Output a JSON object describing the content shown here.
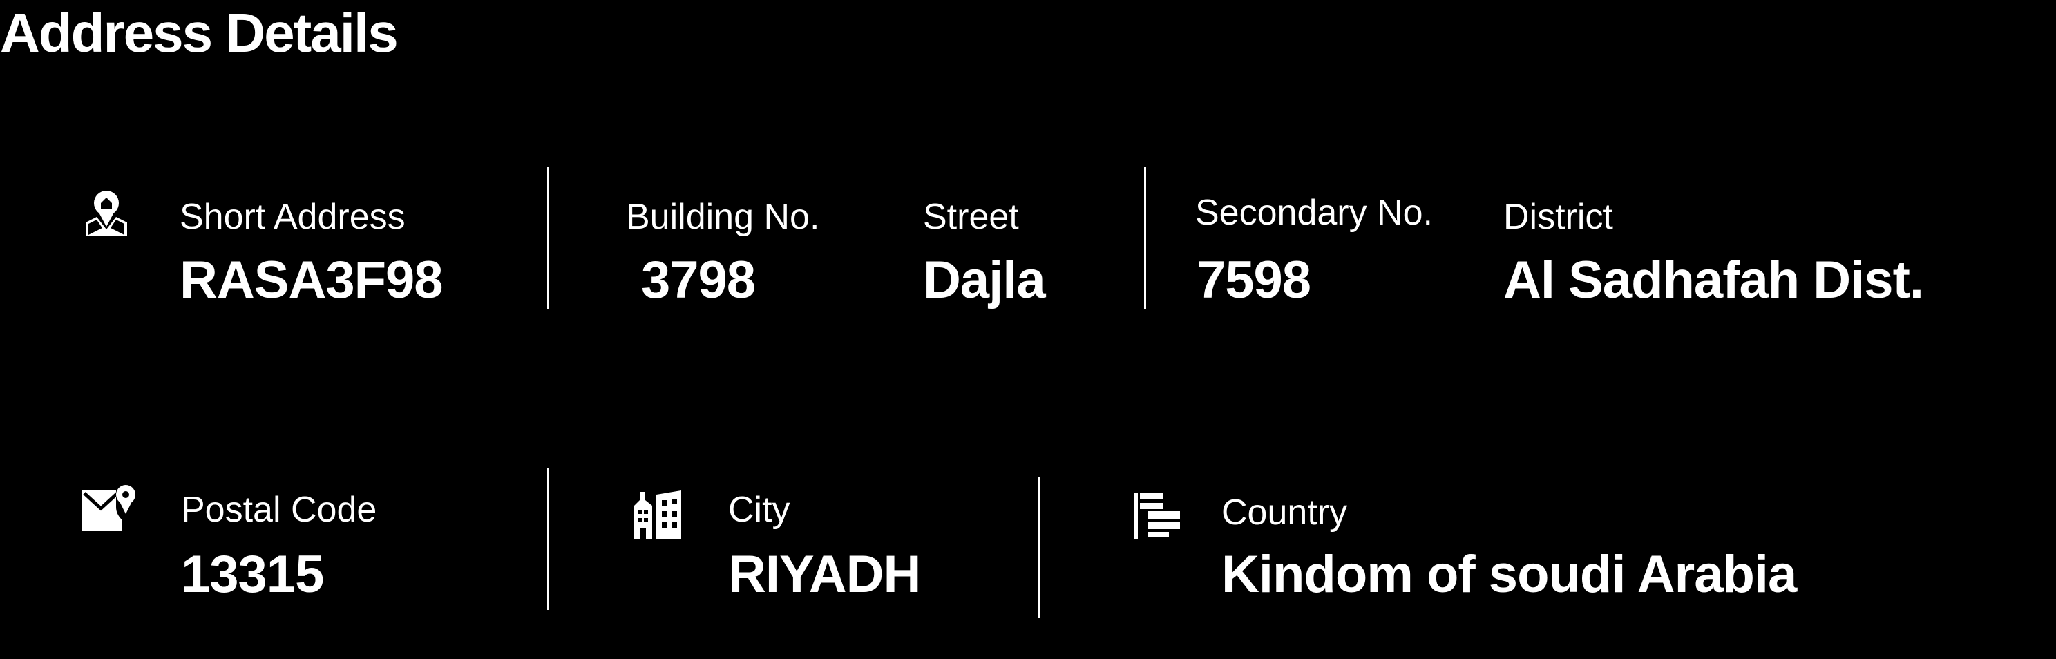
{
  "title": "Address Details",
  "row1": {
    "short_address": {
      "label": "Short Address",
      "value": "RASA3F98"
    },
    "building_no": {
      "label": "Building No.",
      "value": "3798"
    },
    "street": {
      "label": "Street",
      "value": "Dajla"
    },
    "secondary_no": {
      "label": "Secondary No.",
      "value": "7598"
    },
    "district": {
      "label": "District",
      "value": "Al Sadhafah Dist."
    }
  },
  "row2": {
    "postal_code": {
      "label": "Postal Code",
      "value": "13315"
    },
    "city": {
      "label": "City",
      "value": "RIYADH"
    },
    "country": {
      "label": "Country",
      "value": "Kindom of soudi Arabia"
    }
  },
  "icons": {
    "short_address": "map-location-home-icon",
    "postal_code": "mail-location-icon",
    "city": "city-buildings-icon",
    "country": "flag-icon"
  },
  "colors": {
    "background": "#000000",
    "text": "#ffffff"
  }
}
